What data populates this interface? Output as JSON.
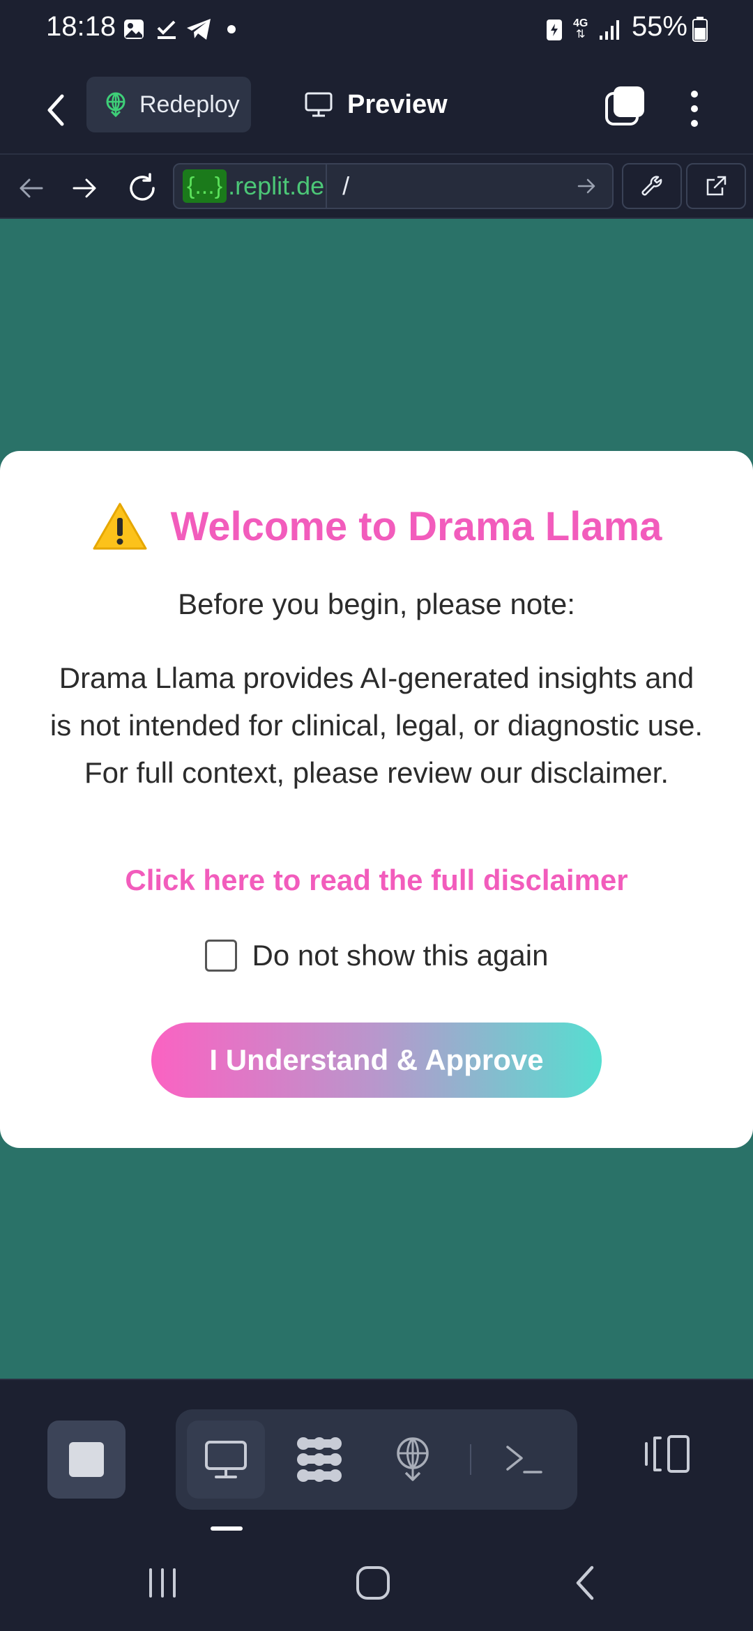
{
  "status_bar": {
    "time": "18:18",
    "network": "4G",
    "battery_percent": "55%",
    "icons": [
      "gallery-icon",
      "task-done-icon",
      "telegram-icon",
      "notification-dot-icon",
      "battery-saver-icon",
      "network-4g-icon",
      "signal-icon",
      "battery-icon"
    ]
  },
  "header": {
    "redeploy_label": "Redeploy",
    "preview_label": "Preview"
  },
  "url_bar": {
    "tag": "{...}",
    "domain": ".replit.de",
    "path": "/"
  },
  "modal": {
    "title": "Welcome to Drama Llama",
    "subtitle": "Before you begin, please note:",
    "body": "Drama Llama provides AI-generated insights and is not intended for clinical, legal, or diagnostic use. For full context, please review our disclaimer.",
    "link_text": "Click here to read the full disclaimer",
    "checkbox_label": "Do not show this again",
    "checkbox_checked": false,
    "approve_label": "I Understand & Approve"
  },
  "colors": {
    "app_background": "#1c2030",
    "content_background": "#2a7268",
    "accent_pink": "#f25cbc",
    "gradient_start": "#fb62c2",
    "gradient_end": "#55ded0",
    "url_domain": "#4cc777"
  },
  "bottom_toolbar": {
    "icons": [
      "stop-icon",
      "webview-icon",
      "workflows-icon",
      "deploy-icon",
      "console-icon",
      "layout-icon"
    ]
  }
}
